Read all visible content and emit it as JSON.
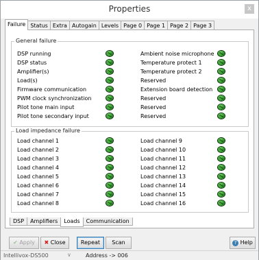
{
  "window": {
    "title": "Properties",
    "close_glyph": "x"
  },
  "top_tabs": [
    "Failure",
    "Status",
    "Extra",
    "Autogain",
    "Levels",
    "Page 0",
    "Page 1",
    "Page 2",
    "Page 3"
  ],
  "general_failure": {
    "title": "General failure",
    "left": [
      "DSP running",
      "DSP status",
      "Amplifier(s)",
      "Load(s)",
      "Firmware communication",
      "PWM clock synchronization",
      "Pilot tone main input",
      "Pilot tone secondary input"
    ],
    "right": [
      "Ambient noise microphone",
      "Temperature protect 1",
      "Temperature protect 2",
      "Reserved",
      "Extension board detection",
      "Reserved",
      "Reserved",
      "Reserved"
    ]
  },
  "load_impedance": {
    "title": "Load impedance failure",
    "left": [
      "Load channel 1",
      "Load channel 2",
      "Load channel 3",
      "Load channel 4",
      "Load channel 5",
      "Load channel 6",
      "Load channel 7",
      "Load channel 8"
    ],
    "right": [
      "Load channel 9",
      "Load channel 10",
      "Load channel 11",
      "Load channel 12",
      "Load channel 13",
      "Load channel 14",
      "Load channel 15",
      "Load channel 16"
    ]
  },
  "bottom_tabs": [
    "DSP",
    "Amplifiers",
    "Loads",
    "Communication"
  ],
  "buttons": {
    "apply": "Apply",
    "close": "Close",
    "repeat": "Repeat",
    "scan": "Scan",
    "help": "Help"
  },
  "status": {
    "device": "Intellivox-DS500",
    "address": "Address -> 006"
  },
  "colors": {
    "led": "#2f9a2a",
    "accent": "#3c7fb1"
  }
}
